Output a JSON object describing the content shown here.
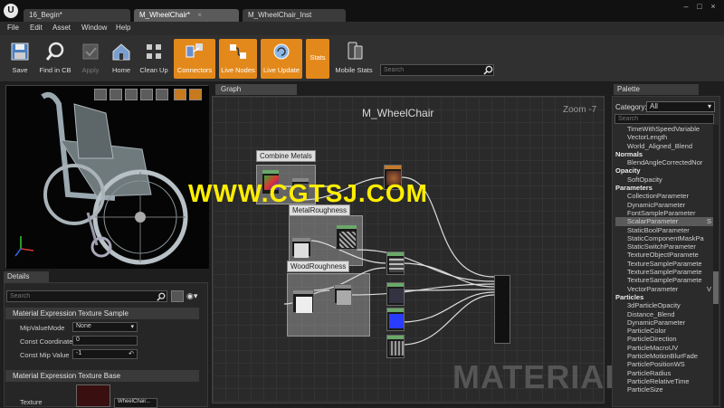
{
  "titlebar": {
    "logo": "U",
    "tabs": [
      {
        "label": "16_Begin*",
        "active": false
      },
      {
        "label": "M_WheelChair*",
        "active": true
      },
      {
        "label": "M_WheelChair_Inst",
        "active": false
      }
    ],
    "close_glyph": "×",
    "window_controls": {
      "minimize": "–",
      "maximize": "□",
      "close": "×"
    }
  },
  "menu": [
    "File",
    "Edit",
    "Asset",
    "Window",
    "Help"
  ],
  "toolbar": {
    "buttons": [
      {
        "label": "Save",
        "icon": "save-icon",
        "state": "normal"
      },
      {
        "label": "Find in CB",
        "icon": "magnifier-icon",
        "state": "normal"
      },
      {
        "label": "Apply",
        "icon": "apply-icon",
        "state": "disabled"
      },
      {
        "label": "Home",
        "icon": "home-icon",
        "state": "normal"
      },
      {
        "label": "Clean Up",
        "icon": "broom-icon",
        "state": "normal"
      },
      {
        "label": "Connectors",
        "icon": "connectors-icon",
        "state": "active"
      },
      {
        "label": "Live Nodes",
        "icon": "live-nodes-icon",
        "state": "active"
      },
      {
        "label": "Live Update",
        "icon": "live-update-icon",
        "state": "active"
      },
      {
        "label": "Stats",
        "icon": "stats-icon",
        "state": "active"
      },
      {
        "label": "Mobile Stats",
        "icon": "mobile-stats-icon",
        "state": "normal"
      }
    ],
    "search_placeholder": "Search"
  },
  "details": {
    "tab_label": "Details",
    "search_placeholder": "Search",
    "section1": "Material Expression Texture Sample",
    "props": [
      {
        "label": "MipValueMode",
        "value": "None"
      },
      {
        "label": "Const Coordinate",
        "value": "0"
      },
      {
        "label": "Const Mip Value",
        "value": "-1"
      }
    ],
    "section2": "Material Expression Texture Base",
    "texture_label": "Texture",
    "texture_value": "WheelChair..."
  },
  "graph": {
    "tab_label": "Graph",
    "title": "M_WheelChair",
    "zoom": "Zoom -7",
    "comments": [
      "Combine Metals",
      "MetalRoughness",
      "WoodRoughness"
    ],
    "watermark_big": "MATERIAL",
    "overlay_text": "WWW.CGTSJ.COM"
  },
  "palette": {
    "tab_label": "Palette",
    "category_label": "Category:",
    "category_value": "All",
    "search_placeholder": "Search",
    "rows": [
      {
        "text": "TimeWithSpeedVariable",
        "type": "item"
      },
      {
        "text": "VectorLength",
        "type": "item"
      },
      {
        "text": "World_Aligned_Blend",
        "type": "item"
      },
      {
        "text": "Normals",
        "type": "cat"
      },
      {
        "text": "BlendAngleCorrectedNor",
        "type": "item"
      },
      {
        "text": "Opacity",
        "type": "cat"
      },
      {
        "text": "SoftOpacity",
        "type": "item"
      },
      {
        "text": "Parameters",
        "type": "cat"
      },
      {
        "text": "CollectionParameter",
        "type": "item"
      },
      {
        "text": "DynamicParameter",
        "type": "item"
      },
      {
        "text": "FontSampleParameter",
        "type": "item"
      },
      {
        "text": "ScalarParameter",
        "type": "item",
        "selected": true,
        "suffix": "S"
      },
      {
        "text": "StaticBoolParameter",
        "type": "item"
      },
      {
        "text": "StaticComponentMaskPa",
        "type": "item"
      },
      {
        "text": "StaticSwitchParameter",
        "type": "item"
      },
      {
        "text": "TextureObjectParamete",
        "type": "item"
      },
      {
        "text": "TextureSampleParamete",
        "type": "item"
      },
      {
        "text": "TextureSampleParamete",
        "type": "item"
      },
      {
        "text": "TextureSampleParamete",
        "type": "item"
      },
      {
        "text": "VectorParameter",
        "type": "item",
        "suffix": "V"
      },
      {
        "text": "Particles",
        "type": "cat"
      },
      {
        "text": "3dParticleOpacity",
        "type": "item"
      },
      {
        "text": "Distance_Blend",
        "type": "item"
      },
      {
        "text": "DynamicParameter",
        "type": "item"
      },
      {
        "text": "ParticleColor",
        "type": "item"
      },
      {
        "text": "ParticleDirection",
        "type": "item"
      },
      {
        "text": "ParticleMacroUV",
        "type": "item"
      },
      {
        "text": "ParticleMotionBlurFade",
        "type": "item"
      },
      {
        "text": "ParticlePositionWS",
        "type": "item"
      },
      {
        "text": "ParticleRadius",
        "type": "item"
      },
      {
        "text": "ParticleRelativeTime",
        "type": "item"
      },
      {
        "text": "ParticleSize",
        "type": "item"
      }
    ]
  },
  "colors": {
    "accent": "#e3891b",
    "watermark": "#ffee00",
    "selection": "#5a5a5a"
  }
}
